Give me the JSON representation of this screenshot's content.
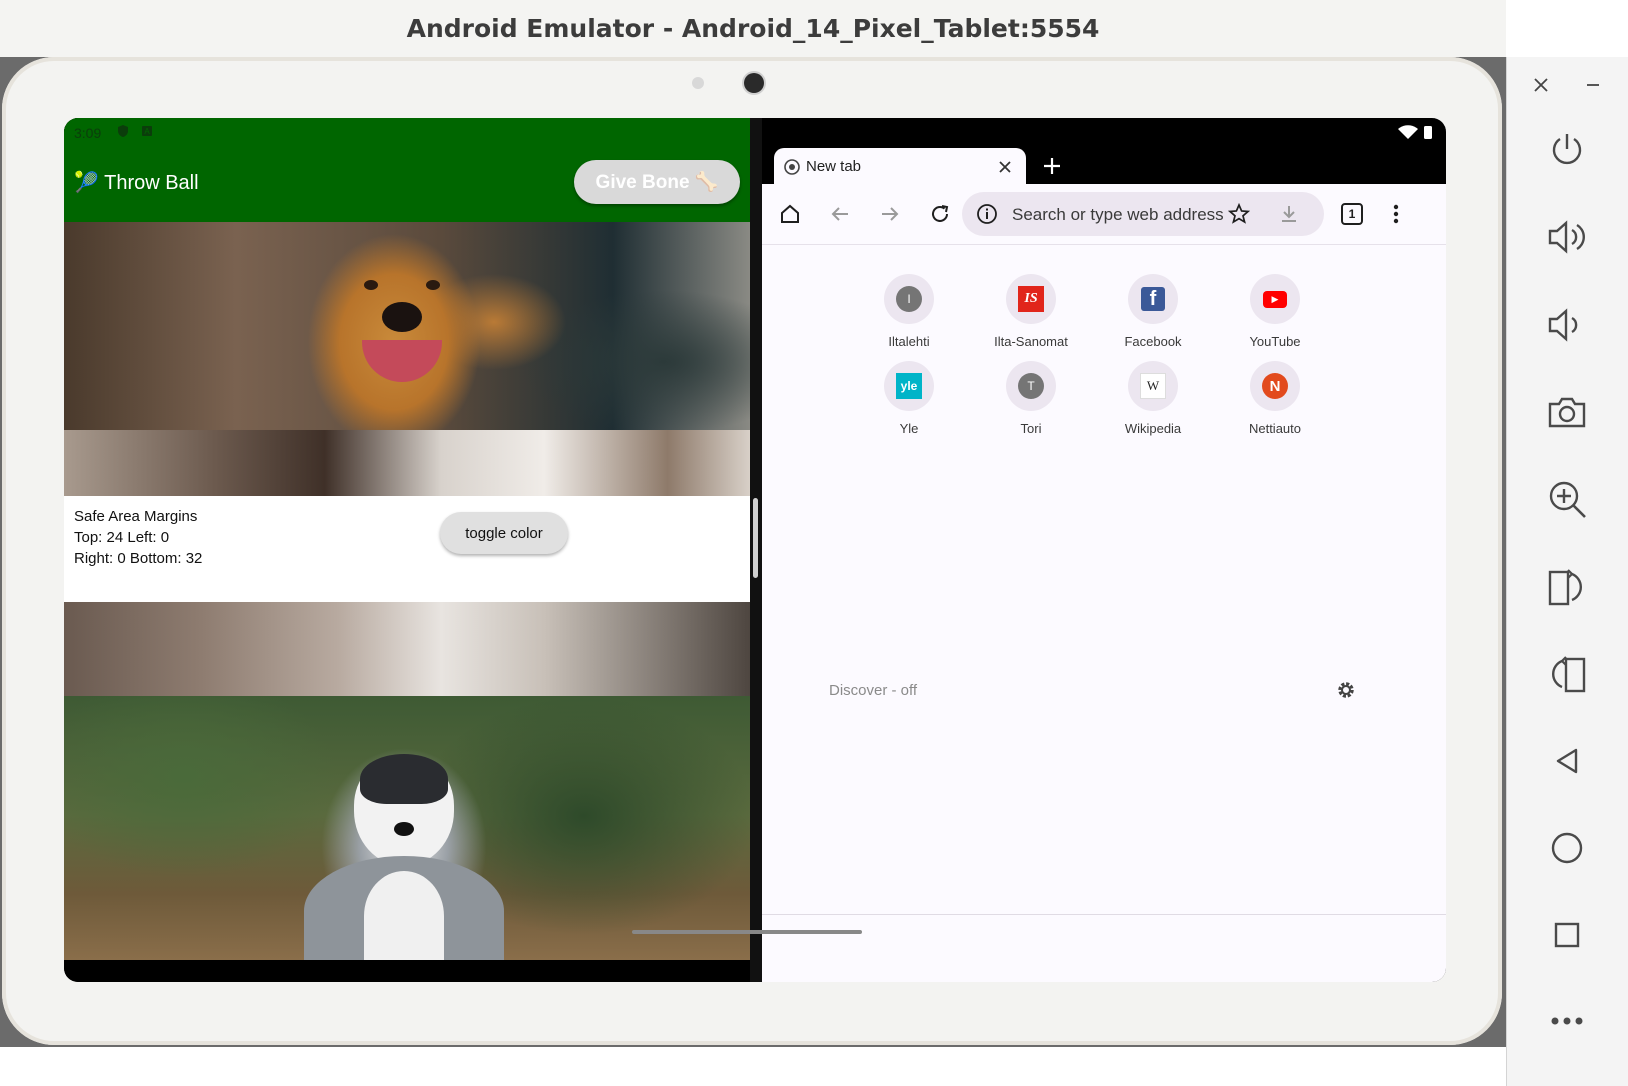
{
  "window": {
    "title": "Android Emulator - Android_14_Pixel_Tablet:5554"
  },
  "left_app": {
    "status_time": "3:09",
    "throw_label": "🎾 Throw Ball",
    "give_bone_label": "Give Bone 🦴",
    "safe_area": {
      "title": "Safe Area Margins",
      "line1": "Top: 24 Left: 0",
      "line2": "Right: 0 Bottom: 32"
    },
    "toggle_label": "toggle color"
  },
  "browser": {
    "tab_title": "New tab",
    "omnibox_placeholder": "Search or type web address",
    "tab_count": "1",
    "shortcuts": [
      {
        "label": "Iltalehti",
        "glyph": "I"
      },
      {
        "label": "Ilta-Sanomat",
        "glyph": "IS"
      },
      {
        "label": "Facebook",
        "glyph": "f"
      },
      {
        "label": "YouTube",
        "glyph": "▶"
      },
      {
        "label": "Yle",
        "glyph": "yle"
      },
      {
        "label": "Tori",
        "glyph": "T"
      },
      {
        "label": "Wikipedia",
        "glyph": "W"
      },
      {
        "label": "Nettiauto",
        "glyph": "N"
      }
    ],
    "discover_label": "Discover - off"
  },
  "colors": {
    "app_bar": "#006600",
    "browser_bg": "#fcfaff",
    "omnibox_bg": "#ece6f0"
  }
}
